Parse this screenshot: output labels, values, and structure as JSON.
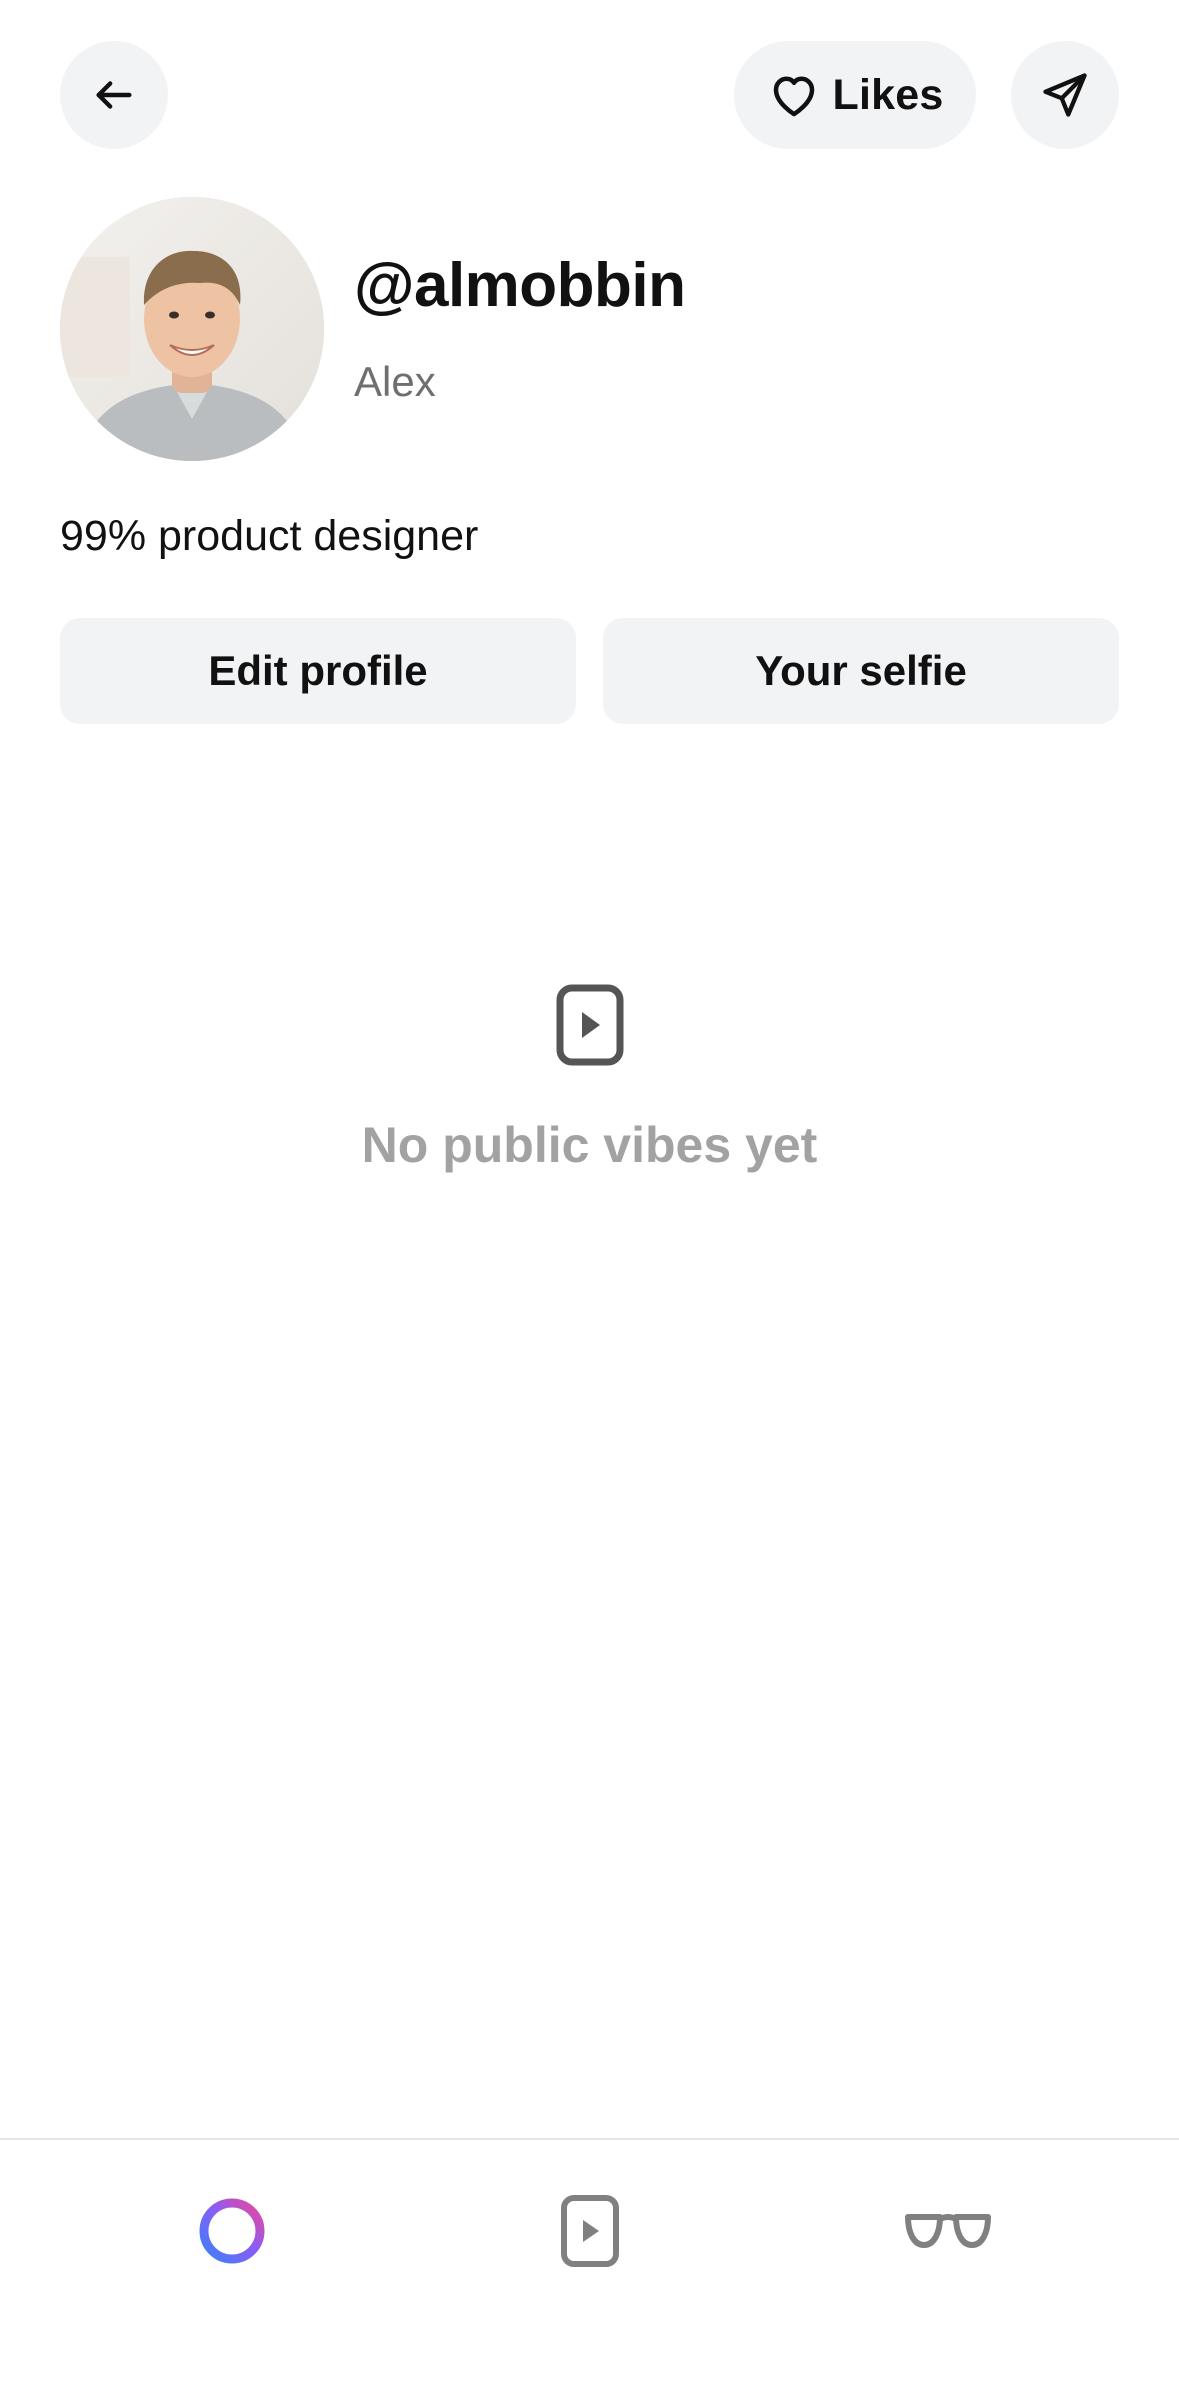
{
  "header": {
    "back_icon": "arrow-left-icon",
    "likes_label": "Likes",
    "likes_icon": "heart-outline-icon",
    "share_icon": "paper-plane-icon"
  },
  "profile": {
    "avatar_alt": "profile photo",
    "handle": "@almobbin",
    "display_name": "Alex",
    "bio": "99% product designer"
  },
  "actions": {
    "edit_label": "Edit profile",
    "selfie_label": "Your selfie"
  },
  "empty_state": {
    "icon": "play-square-icon",
    "message": "No public vibes yet"
  },
  "bottom_nav": {
    "items": [
      {
        "icon": "gradient-ring-icon",
        "active": true
      },
      {
        "icon": "play-square-icon",
        "active": false
      },
      {
        "icon": "glasses-icon",
        "active": false
      }
    ]
  },
  "colors": {
    "button_bg": "#f2f3f5",
    "text_primary": "#111111",
    "text_secondary": "#6f6f6f",
    "text_muted": "#a2a2a2",
    "ring_gradient": [
      "#3b82f6",
      "#8b5cf6",
      "#ec4899"
    ]
  }
}
